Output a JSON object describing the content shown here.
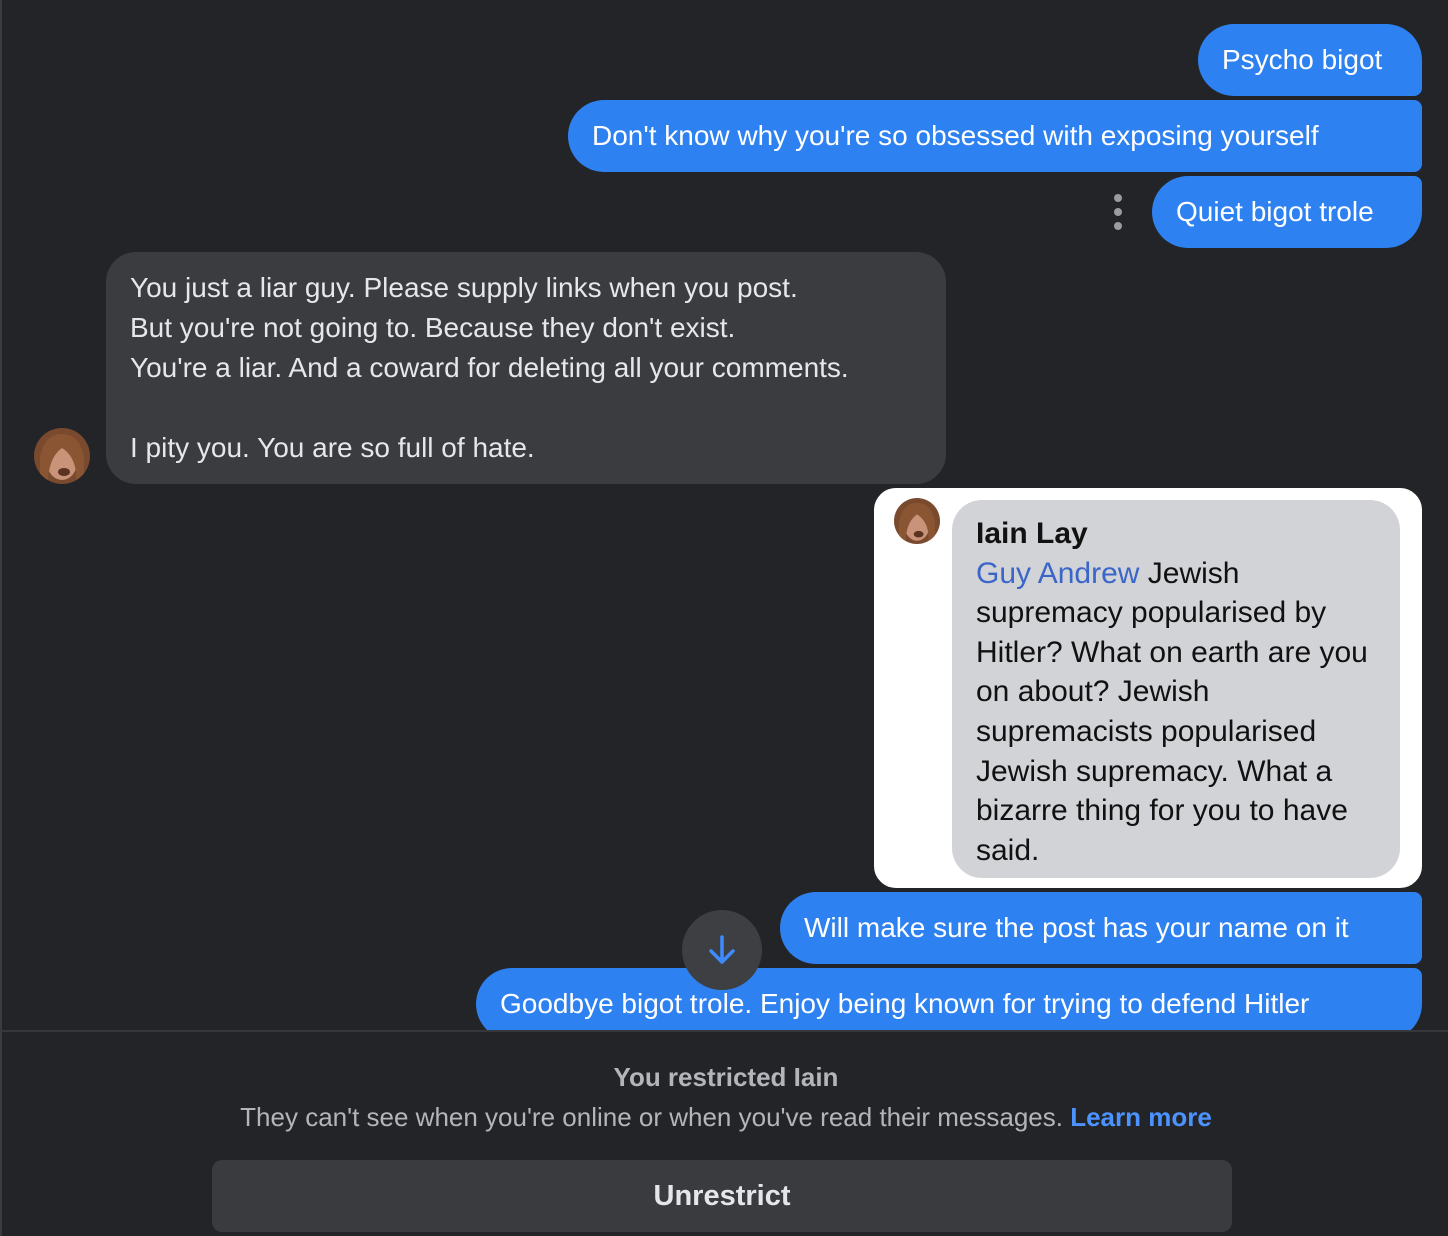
{
  "messages": {
    "out_1": "Psycho bigot",
    "out_2": "Don't know why you're so obsessed with exposing yourself",
    "out_3": "Quiet bigot trole",
    "in_1": "You just a liar guy. Please supply links when you post.\nBut you're not going to. Because they don't exist.\nYou're a liar. And a coward for deleting all your comments.\n\nI pity you. You are so full of hate.",
    "out_5": "Will make sure the post has your name on it",
    "out_6": "Goodbye bigot trole. Enjoy being known for trying to defend Hitler"
  },
  "screenshot": {
    "author": "Iain Lay",
    "mention": "Guy Andrew",
    "text": " Jewish supremacy popularised by Hitler? What on earth are you on about? Jewish supremacists popularised Jewish supremacy. What a bizarre thing for you to have said."
  },
  "footer": {
    "title": "You restricted Iain",
    "description": "They can't see when you're online or when you've read their messages. ",
    "learn_more": "Learn more",
    "unrestrict": "Unrestrict"
  },
  "colors": {
    "background": "#232427",
    "outgoing_bubble": "#2e81f0",
    "incoming_bubble": "#3b3c3f",
    "link": "#4c93ff"
  },
  "icons": {
    "more": "more-options-icon",
    "scroll": "arrow-down-icon"
  }
}
